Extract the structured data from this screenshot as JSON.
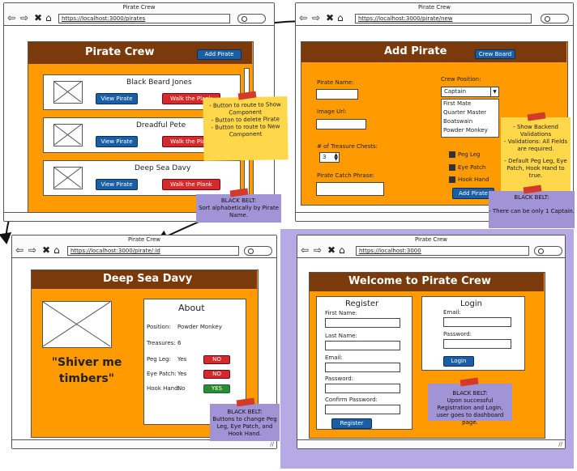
{
  "window1": {
    "title": "Pirate Crew",
    "url": "https://localhost:3000/pirates",
    "header": "Pirate Crew",
    "add_button": "Add Pirate",
    "pirates": [
      {
        "name": "Black Beard Jones",
        "view": "View Pirate",
        "plank": "Walk the Plank"
      },
      {
        "name": "Dreadful Pete",
        "view": "View Pirate",
        "plank": "Walk the Plank"
      },
      {
        "name": "Deep Sea Davy",
        "view": "View Pirate",
        "plank": "Walk the Plank"
      }
    ],
    "note_yellow": [
      "- Button to route to Show Component",
      "- Button to delete Pirate",
      "- Button to route to New Component"
    ],
    "note_black_belt_title": "BLACK BELT:",
    "note_black_belt_text": "Sort alphabetically by Pirate Name."
  },
  "window2": {
    "title": "Pirate Crew",
    "url": "https://localhost:3000/pirate/new",
    "header": "Add Pirate",
    "crew_board_button": "Crew Board",
    "pirate_name_label": "Pirate Name:",
    "image_url_label": "Image Url:",
    "treasure_label": "# of Treasure Chests:",
    "treasure_value": "3",
    "catch_phrase_label": "Pirate Catch Phrase:",
    "crew_position_label": "Crew Position:",
    "crew_position_selected": "Captain",
    "crew_position_options": [
      "First Mate",
      "Quarter Master",
      "Boatswain",
      "Powder Monkey"
    ],
    "checkboxes": [
      "Peg Leg",
      "Eye Patch",
      "Hook Hand"
    ],
    "add_button": "Add Pirate",
    "note_yellow": [
      "- Show Backend Validations",
      "- Validations: All Fields are required.",
      "",
      "- Default Peg Leg, Eye Patch, Hook Hand to true."
    ],
    "note_black_belt_title": "BLACK BELT:",
    "note_black_belt_text": "- There can be only 1 Captain."
  },
  "window3": {
    "title": "Pirate Crew",
    "url": "https://localhost:3000/pirate/:id",
    "header": "Deep Sea Davy",
    "quote": "\"Shiver me timbers\"",
    "about_title": "About",
    "position_label": "Position:",
    "position_value": "Powder Monkey",
    "treasures_label": "Treasures:",
    "treasures_value": "6",
    "peg_leg_label": "Peg Leg:",
    "peg_leg_value": "Yes",
    "peg_leg_btn": "NO",
    "eye_patch_label": "Eye Patch:",
    "eye_patch_value": "Yes",
    "eye_patch_btn": "NO",
    "hook_hand_label": "Hook Hand:",
    "hook_hand_value": "No",
    "hook_hand_btn": "YES",
    "note_black_belt_title": "BLACK BELT:",
    "note_black_belt_text": "Buttons to change Peg Leg, Eye Patch, and Hook Hand."
  },
  "window4": {
    "title": "Pirate Crew",
    "url": "https://localhost:3000",
    "header": "Welcome to Pirate Crew",
    "register_title": "Register",
    "first_name_label": "First Name:",
    "last_name_label": "Last Name:",
    "email_label": "Email:",
    "password_label": "Password:",
    "confirm_password_label": "Confirm Password:",
    "register_button": "Register",
    "login_title": "Login",
    "login_email_label": "Email:",
    "login_password_label": "Password:",
    "login_button": "Login",
    "note_black_belt_title": "BLACK BELT:",
    "note_black_belt_text": "Upon successful Registration and Login, user goes to dashboard page."
  },
  "colors": {
    "panel_orange": "#ff9b00",
    "header_brown": "#7a3a0c",
    "button_blue": "#1a5fa6",
    "button_red": "#d32a2a",
    "button_green": "#2f8a2f",
    "note_yellow": "#ffd74a",
    "note_purple": "#a093d6",
    "background_purple": "#b6a9e4"
  }
}
